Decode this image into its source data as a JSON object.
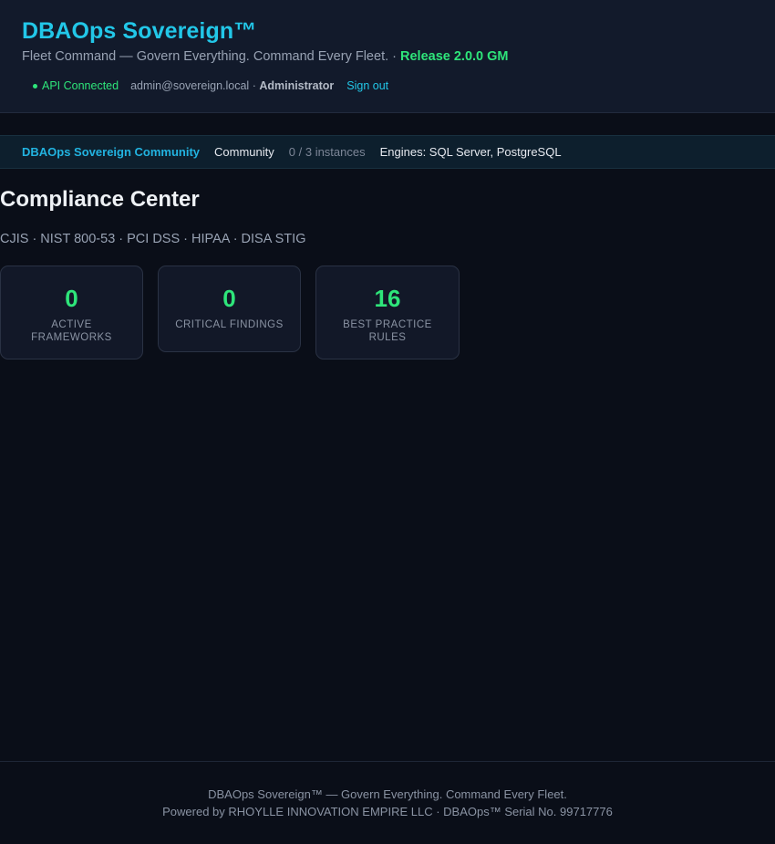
{
  "header": {
    "app_title": "DBAOps Sovereign™",
    "tagline": "Fleet Command — Govern Everything. Command Every Fleet.",
    "release_separator": " · ",
    "release": "Release 2.0.0 GM",
    "api_status": "API Connected",
    "user_email": "admin@sovereign.local",
    "user_separator": " · ",
    "user_role": "Administrator",
    "signout_label": "Sign out"
  },
  "edition": {
    "name": "DBAOps Sovereign Community",
    "tier": "Community",
    "instances": "0 / 3 instances",
    "engines": "Engines: SQL Server, PostgreSQL"
  },
  "main": {
    "title": "Compliance Center",
    "frameworks": "CJIS · NIST 800-53 · PCI DSS · HIPAA · DISA STIG",
    "stats": [
      {
        "value": "0",
        "label": "Active Frameworks"
      },
      {
        "value": "0",
        "label": "Critical Findings"
      },
      {
        "value": "16",
        "label": "Best Practice Rules"
      }
    ]
  },
  "footer": {
    "line1": "DBAOps Sovereign™ — Govern Everything. Command Every Fleet.",
    "line2": "Powered by RHOYLLE INNOVATION EMPIRE LLC · DBAOps™ Serial No. 99717776"
  },
  "colors": {
    "accent": "#22c7e8",
    "success": "#2ee57a",
    "background": "#0a0e18"
  }
}
